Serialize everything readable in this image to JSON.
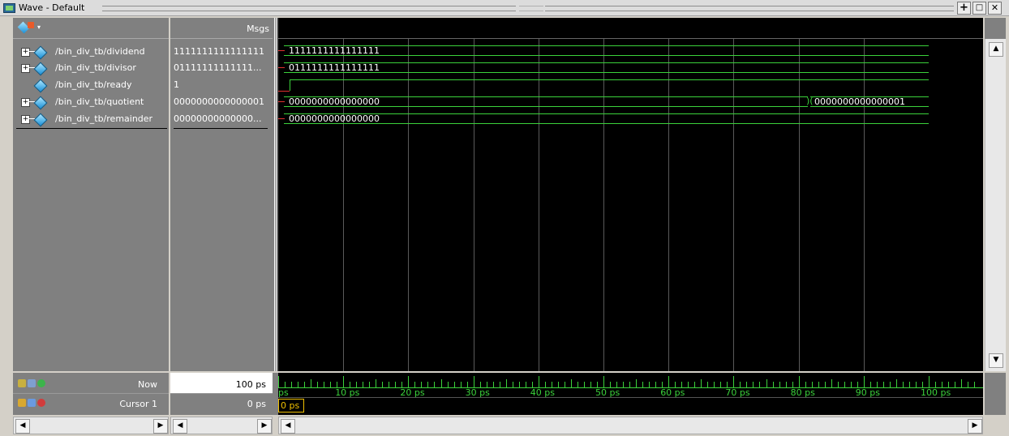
{
  "window": {
    "title": "Wave - Default",
    "buttons": [
      "+",
      "□",
      "✕"
    ]
  },
  "header": {
    "msgs_label": "Msgs"
  },
  "signals": [
    {
      "name": "/bin_div_tb/dividend",
      "msg": "1111111111111111",
      "expandable": true
    },
    {
      "name": "/bin_div_tb/divisor",
      "msg": "01111111111111...",
      "expandable": true
    },
    {
      "name": "/bin_div_tb/ready",
      "msg": "1",
      "expandable": false
    },
    {
      "name": "/bin_div_tb/quotient",
      "msg": "0000000000000001",
      "expandable": true
    },
    {
      "name": "/bin_div_tb/remainder",
      "msg": "00000000000000...",
      "expandable": true
    }
  ],
  "waves": {
    "dividend": "1111111111111111",
    "divisor": "0111111111111111",
    "quotient_before": "0000000000000000",
    "quotient_after": "0000000000000001",
    "quotient_change_ps": 81,
    "remainder": "0000000000000000",
    "ready_rise_ps": 0.2
  },
  "timeline": {
    "start_label": "ps",
    "ticks": [
      "10 ps",
      "20 ps",
      "30 ps",
      "40 ps",
      "50 ps",
      "60 ps",
      "70 ps",
      "80 ps",
      "90 ps",
      "100 ps"
    ],
    "range_ps": [
      0,
      100
    ]
  },
  "status": {
    "now_label": "Now",
    "now_value": "100 ps",
    "cursor_label": "Cursor 1",
    "cursor_value": "0 ps",
    "cursor_tag": "0 ps"
  },
  "colors": {
    "wave": "#3bd23b",
    "background": "#000000",
    "cursor": "#f0c000"
  }
}
